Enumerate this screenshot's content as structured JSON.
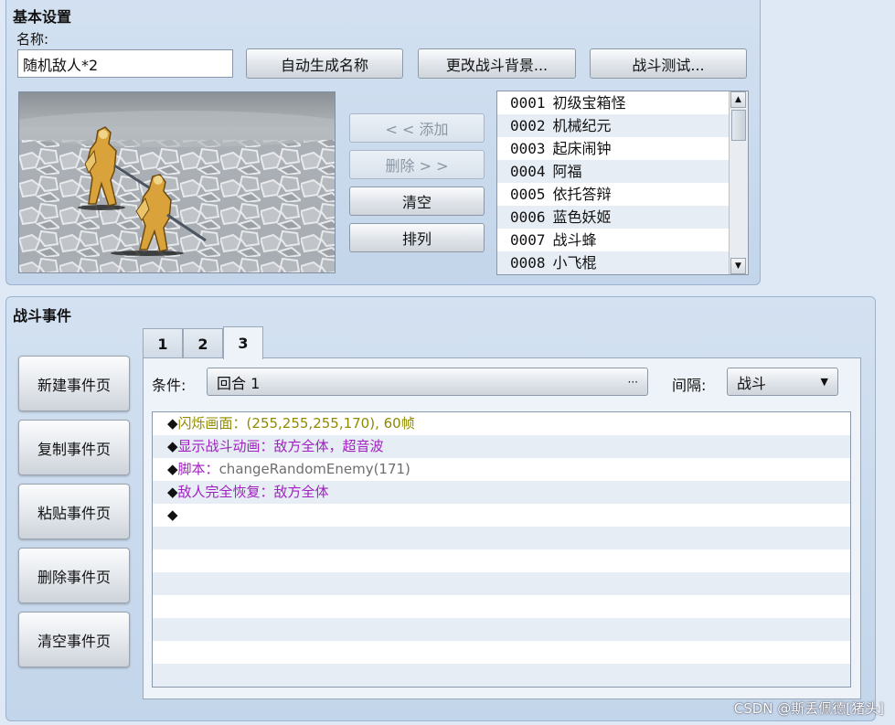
{
  "basic": {
    "title": "基本设置",
    "name_label": "名称:",
    "name_value": "随机敌人*2",
    "auto_name_button": "自动生成名称",
    "change_bg_button": "更改战斗背景...",
    "battle_test_button": "战斗测试...",
    "add_button": "< < 添加",
    "remove_button": "删除 > >",
    "clear_button": "清空",
    "arrange_button": "排列",
    "enemies": [
      {
        "id": "0001",
        "name": "初级宝箱怪"
      },
      {
        "id": "0002",
        "name": "机械纪元"
      },
      {
        "id": "0003",
        "name": "起床闹钟"
      },
      {
        "id": "0004",
        "name": "阿福"
      },
      {
        "id": "0005",
        "name": "依托答辩"
      },
      {
        "id": "0006",
        "name": "蓝色妖姬"
      },
      {
        "id": "0007",
        "name": "战斗蜂"
      },
      {
        "id": "0008",
        "name": "小飞棍"
      }
    ]
  },
  "events": {
    "title": "战斗事件",
    "buttons": [
      "新建事件页",
      "复制事件页",
      "粘贴事件页",
      "删除事件页",
      "清空事件页"
    ],
    "tabs": [
      "1",
      "2",
      "3"
    ],
    "active_tab": "3",
    "condition_label": "条件:",
    "condition_value": "回合 1",
    "condition_ellipsis": "···",
    "interval_label": "间隔:",
    "interval_value": "战斗",
    "commands": [
      {
        "prefix": "◆",
        "text": "闪烁画面：(255,255,255,170), 60帧",
        "color": "#8f8a00"
      },
      {
        "prefix": "◆",
        "text": "显示战斗动画：敌方全体，超音波",
        "color": "#a020c0"
      },
      {
        "prefix": "◆",
        "label": "脚本：",
        "text": "changeRandomEnemy(171)",
        "color": "#6e6e6e"
      },
      {
        "prefix": "◆",
        "text": "敌人完全恢复：敌方全体",
        "color": "#a020c0"
      },
      {
        "prefix": "◆",
        "text": "",
        "color": "#111111"
      }
    ]
  },
  "watermark": "CSDN @斯丢佩德[猪头]"
}
